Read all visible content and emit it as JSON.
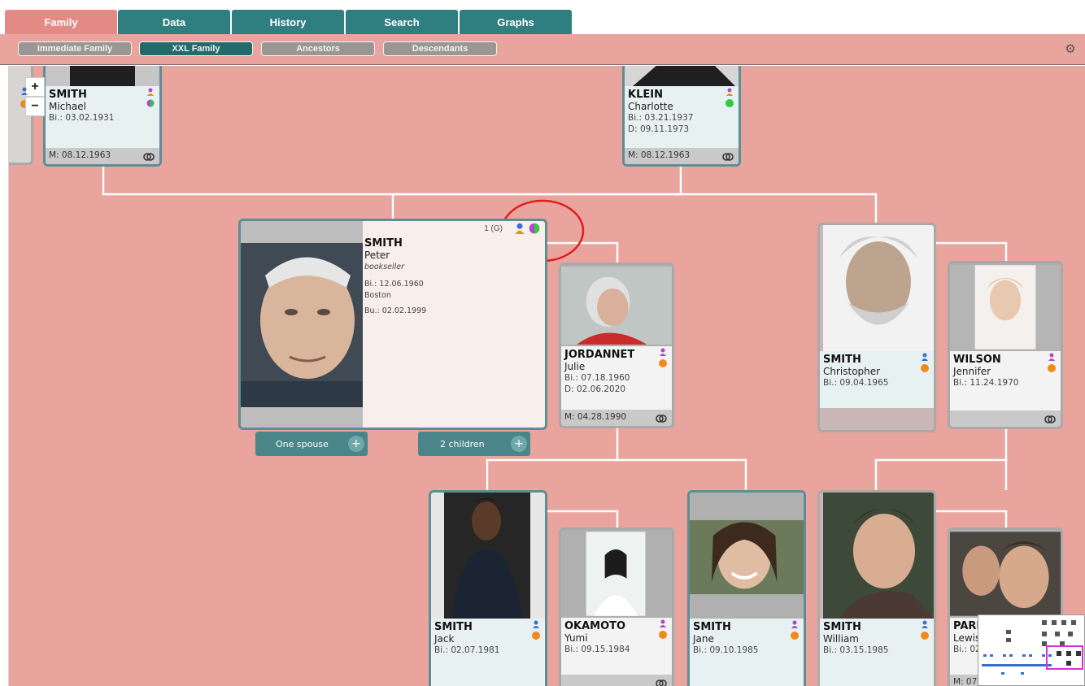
{
  "tabs": [
    "Family",
    "Data",
    "History",
    "Search",
    "Graphs"
  ],
  "subtabs": [
    "Immediate Family",
    "XXL Family",
    "Ancestors",
    "Descendants"
  ],
  "zoom": {
    "plus": "+",
    "minus": "−"
  },
  "colors": {
    "male": "#3a6fd0",
    "female": "#b147c9",
    "orange": "#f08a1b",
    "green": "#2ecc40",
    "accent": "#2f7f80"
  },
  "cards": {
    "michael": {
      "surname": "SMITH",
      "given": "Michael",
      "birth": "Bi.: 03.02.1931",
      "marriage": "M: 08.12.1963"
    },
    "charlotte": {
      "surname": "KLEIN",
      "given": "Charlotte",
      "birth": "Bi.: 03.21.1937",
      "death": "D: 09.11.1973",
      "marriage": "M: 08.12.1963"
    },
    "peter": {
      "surname": "SMITH",
      "given": "Peter",
      "occupation": "bookseller",
      "birth": "Bi.: 12.06.1960",
      "place": "Boston",
      "burial": "Bu.: 02.02.1999",
      "gen": "1 (G)"
    },
    "julie": {
      "surname": "JORDANNET",
      "given": "Julie",
      "birth": "Bi.: 07.18.1960",
      "death": "D: 02.06.2020",
      "marriage": "M: 04.28.1990"
    },
    "christopher": {
      "surname": "SMITH",
      "given": "Christopher",
      "birth": "Bi.: 09.04.1965"
    },
    "jennifer": {
      "surname": "WILSON",
      "given": "Jennifer",
      "birth": "Bi.: 11.24.1970"
    },
    "jack": {
      "surname": "SMITH",
      "given": "Jack",
      "birth": "Bi.: 02.07.1981"
    },
    "yumi": {
      "surname": "OKAMOTO",
      "given": "Yumi",
      "birth": "Bi.: 09.15.1984"
    },
    "jane": {
      "surname": "SMITH",
      "given": "Jane",
      "birth": "Bi.: 09.10.1985"
    },
    "william": {
      "surname": "SMITH",
      "given": "William",
      "birth": "Bi.: 03.15.1985"
    },
    "lewis": {
      "surname": "PARK",
      "given": "Lewis",
      "birth": "Bi.: 02.",
      "marriage": "M: 07.05.2017"
    }
  },
  "buttons": {
    "spouse": "One spouse",
    "children": "2 children",
    "plus": "+"
  }
}
